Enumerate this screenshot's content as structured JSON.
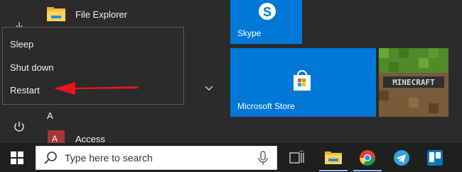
{
  "start_menu": {
    "apps": [
      {
        "label": "File Explorer",
        "icon": "folder-icon"
      },
      {
        "label": "Access",
        "icon": "access-icon"
      }
    ],
    "section_letter": "A",
    "power_menu": {
      "items": [
        {
          "label": "Sleep"
        },
        {
          "label": "Shut down"
        },
        {
          "label": "Restart"
        }
      ]
    }
  },
  "tiles": {
    "skype": {
      "label": "Skype",
      "color": "#0078d7"
    },
    "store": {
      "label": "Microsoft Store",
      "color": "#0078d7"
    },
    "minecraft": {
      "label": "MINECRAFT"
    }
  },
  "taskbar": {
    "search_placeholder": "Type here to search",
    "icons": [
      "windows-icon",
      "search-icon",
      "microphone-icon",
      "task-view-icon",
      "file-explorer-icon",
      "chrome-icon",
      "telegram-icon",
      "trello-icon"
    ],
    "accent": "#8fb7e8"
  },
  "annotation": {
    "arrow_color": "#e8161b"
  }
}
